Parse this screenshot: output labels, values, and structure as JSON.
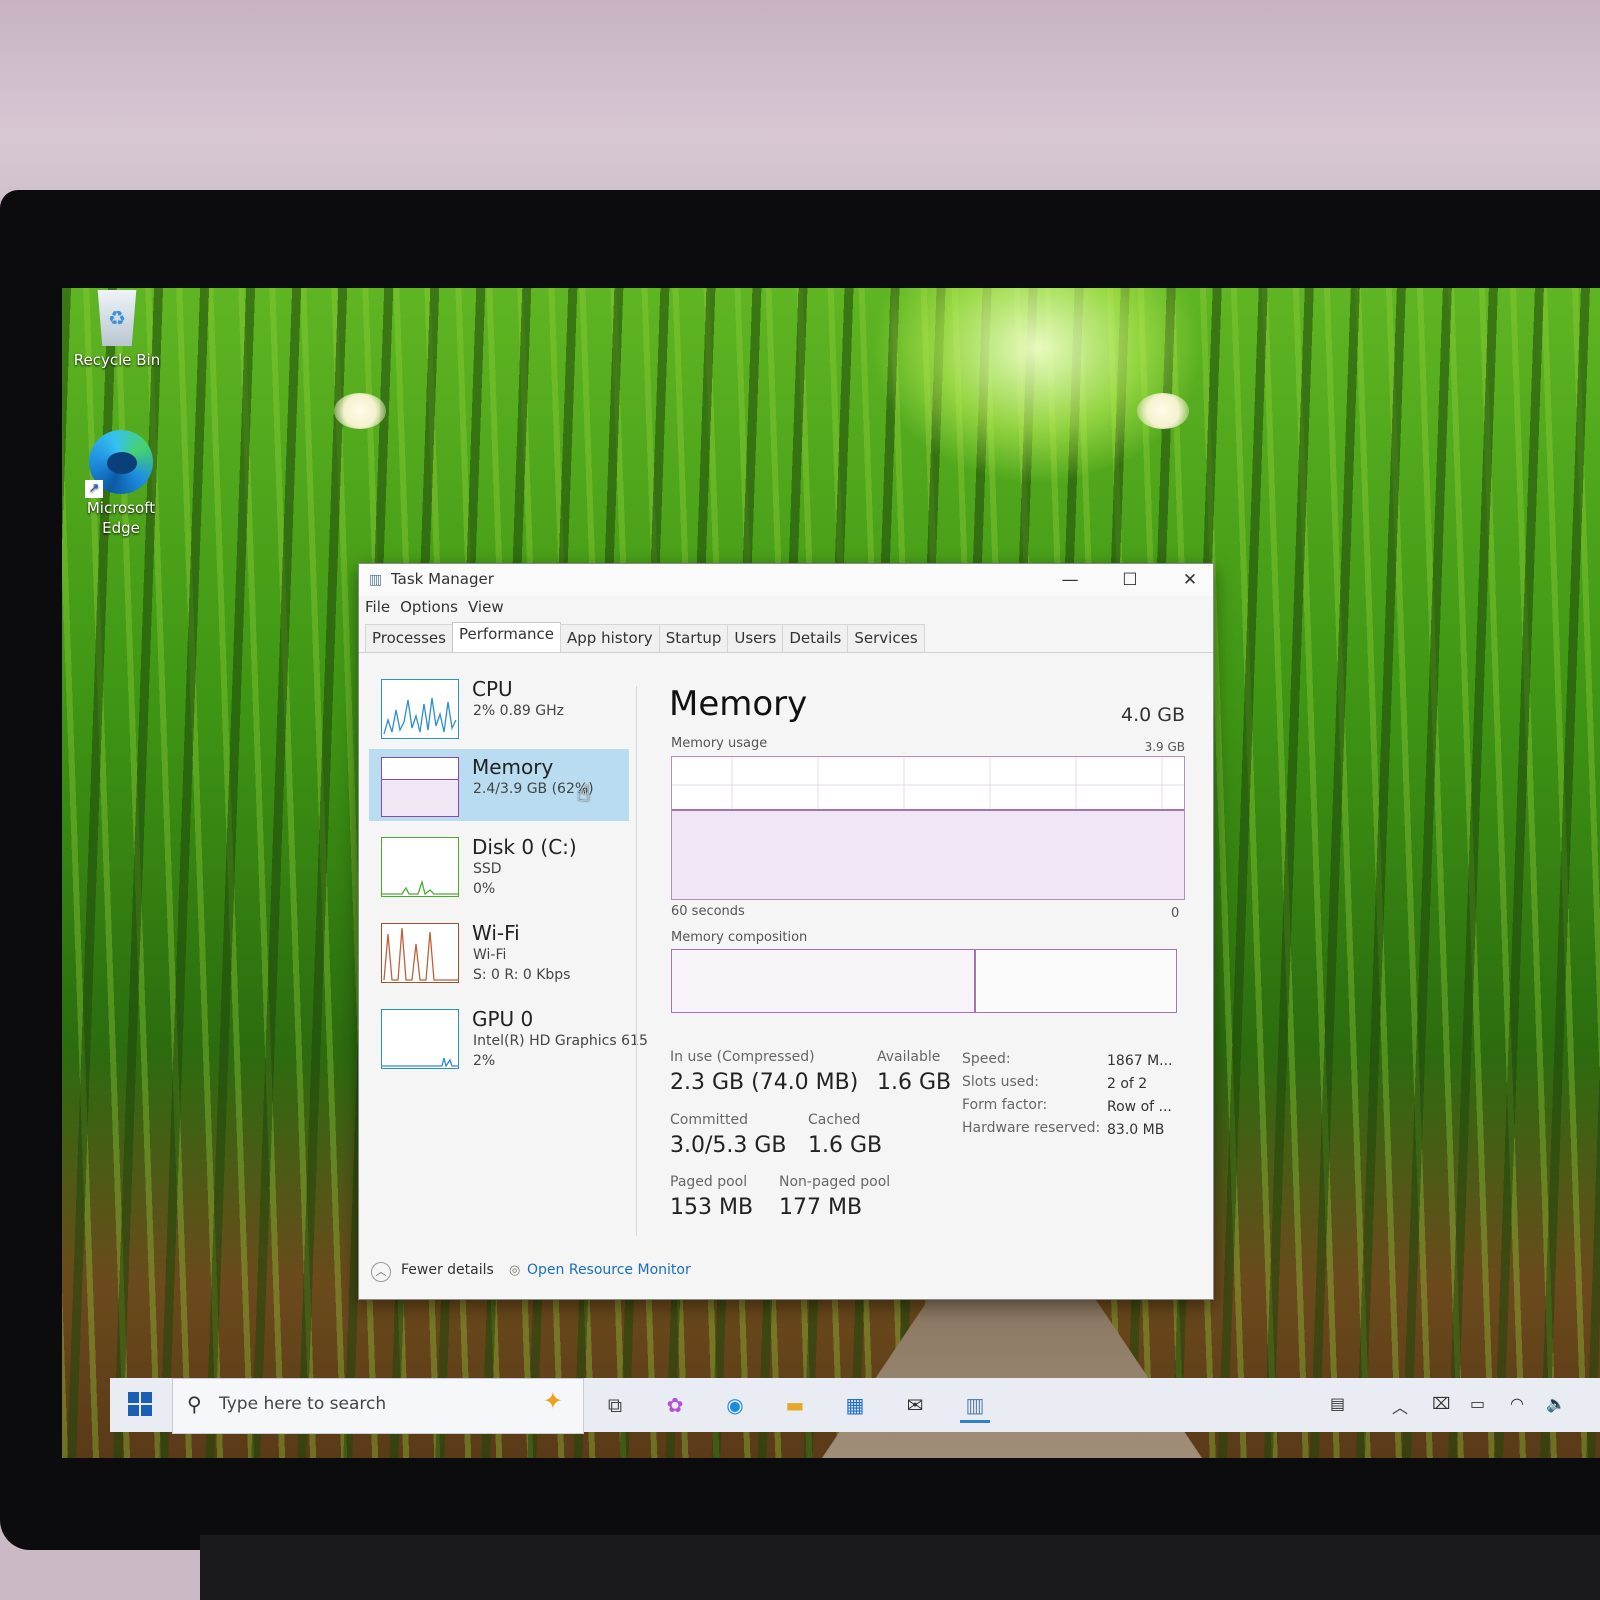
{
  "desktop": {
    "icons": [
      {
        "label": "Recycle Bin"
      },
      {
        "label": "Microsoft Edge"
      }
    ]
  },
  "window": {
    "title": "Task Manager",
    "controls": {
      "minimize": "—",
      "maximize": "☐",
      "close": "✕"
    },
    "menu": [
      "File",
      "Options",
      "View"
    ],
    "tabs": [
      "Processes",
      "Performance",
      "App history",
      "Startup",
      "Users",
      "Details",
      "Services"
    ],
    "active_tab": "Performance"
  },
  "sidebar": {
    "items": [
      {
        "name": "CPU",
        "line1": "2% 0.89 GHz",
        "line2": "",
        "color": "#2d8fd0"
      },
      {
        "name": "Memory",
        "line1": "2.4/3.9 GB (62%)",
        "line2": "",
        "color": "#8b4aa8"
      },
      {
        "name": "Disk 0 (C:)",
        "line1": "SSD",
        "line2": "0%",
        "color": "#4caa32"
      },
      {
        "name": "Wi-Fi",
        "line1": "Wi-Fi",
        "line2": "S: 0 R: 0 Kbps",
        "color": "#a0522d"
      },
      {
        "name": "GPU 0",
        "line1": "Intel(R) HD Graphics 615",
        "line2": "2%",
        "color": "#2d8fd0"
      }
    ],
    "selected": "Memory"
  },
  "memory": {
    "title": "Memory",
    "total": "4.0 GB",
    "usage_label": "Memory usage",
    "usage_max": "3.9 GB",
    "usage_fraction": 0.62,
    "time_label": "60 seconds",
    "time_end": "0",
    "composition_label": "Memory composition",
    "in_use_fraction": 0.6,
    "stats": {
      "in_use_label": "In use (Compressed)",
      "in_use_value": "2.3 GB (74.0 MB)",
      "available_label": "Available",
      "available_value": "1.6 GB",
      "committed_label": "Committed",
      "committed_value": "3.0/5.3 GB",
      "cached_label": "Cached",
      "cached_value": "1.6 GB",
      "paged_label": "Paged pool",
      "paged_value": "153 MB",
      "nonpaged_label": "Non-paged pool",
      "nonpaged_value": "177 MB"
    },
    "details": [
      {
        "key": "Speed:",
        "value": "1867 M..."
      },
      {
        "key": "Slots used:",
        "value": "2 of 2"
      },
      {
        "key": "Form factor:",
        "value": "Row of ..."
      },
      {
        "key": "Hardware reserved:",
        "value": "83.0 MB"
      }
    ]
  },
  "footer": {
    "fewer_details": "Fewer details",
    "resource_monitor": "Open Resource Monitor"
  },
  "taskbar": {
    "search_placeholder": "Type here to search",
    "apps": [
      "task-view",
      "copilot",
      "edge",
      "file-explorer",
      "store",
      "mail",
      "task-manager"
    ]
  }
}
